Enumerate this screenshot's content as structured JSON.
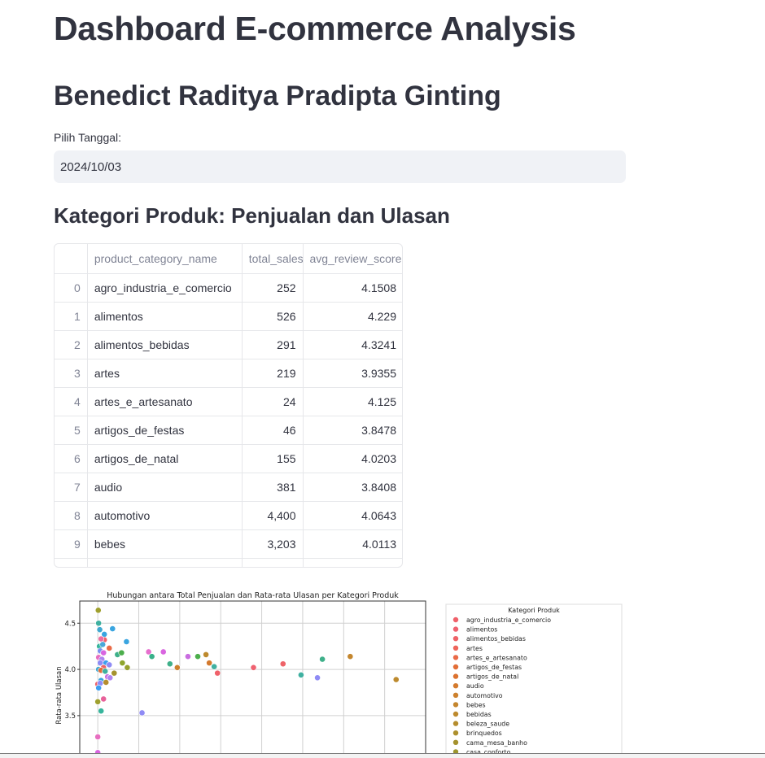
{
  "page": {
    "title": "Dashboard E-commerce Analysis",
    "author": "Benedict Raditya Pradipta Ginting"
  },
  "date_input": {
    "label": "Pilih Tanggal:",
    "value": "2024/10/03"
  },
  "section": {
    "heading": "Kategori Produk: Penjualan dan Ulasan"
  },
  "table": {
    "columns": [
      "",
      "product_category_name",
      "total_sales",
      "avg_review_score"
    ],
    "rows": [
      {
        "index": "0",
        "product_category_name": "agro_industria_e_comercio",
        "total_sales": "252",
        "avg_review_score": "4.1508"
      },
      {
        "index": "1",
        "product_category_name": "alimentos",
        "total_sales": "526",
        "avg_review_score": "4.229"
      },
      {
        "index": "2",
        "product_category_name": "alimentos_bebidas",
        "total_sales": "291",
        "avg_review_score": "4.3241"
      },
      {
        "index": "3",
        "product_category_name": "artes",
        "total_sales": "219",
        "avg_review_score": "3.9355"
      },
      {
        "index": "4",
        "product_category_name": "artes_e_artesanato",
        "total_sales": "24",
        "avg_review_score": "4.125"
      },
      {
        "index": "5",
        "product_category_name": "artigos_de_festas",
        "total_sales": "46",
        "avg_review_score": "3.8478"
      },
      {
        "index": "6",
        "product_category_name": "artigos_de_natal",
        "total_sales": "155",
        "avg_review_score": "4.0203"
      },
      {
        "index": "7",
        "product_category_name": "audio",
        "total_sales": "381",
        "avg_review_score": "3.8408"
      },
      {
        "index": "8",
        "product_category_name": "automotivo",
        "total_sales": "4,400",
        "avg_review_score": "4.0643"
      },
      {
        "index": "9",
        "product_category_name": "bebes",
        "total_sales": "3,203",
        "avg_review_score": "4.0113"
      }
    ]
  },
  "chart_data": {
    "type": "scatter",
    "title": "Hubungan antara Total Penjualan dan Rata-rata Ulasan per Kategori Produk",
    "xlabel": "",
    "ylabel": "Rata-rata Ulasan",
    "y_ticks": [
      "3.5",
      "4.0",
      "4.5"
    ],
    "ylim": [
      3.05,
      4.74
    ],
    "xlim": [
      -1100,
      20000
    ],
    "grid": true,
    "legend": {
      "title": "Kategori Produk",
      "placement": "outside-right",
      "entries": [
        {
          "name": "agro_industria_e_comercio",
          "color": "#f0616a"
        },
        {
          "name": "alimentos",
          "color": "#ef6270"
        },
        {
          "name": "alimentos_bebidas",
          "color": "#ee6368"
        },
        {
          "name": "artes",
          "color": "#ee655b"
        },
        {
          "name": "artes_e_artesanato",
          "color": "#ea6a47"
        },
        {
          "name": "artigos_de_festas",
          "color": "#e36e37"
        },
        {
          "name": "artigos_de_natal",
          "color": "#dc722f"
        },
        {
          "name": "audio",
          "color": "#d47a2e"
        },
        {
          "name": "automotivo",
          "color": "#cd812e"
        },
        {
          "name": "bebes",
          "color": "#c4862e"
        },
        {
          "name": "bebidas",
          "color": "#bd8a2e"
        },
        {
          "name": "beleza_saude",
          "color": "#b58d2e"
        },
        {
          "name": "brinquedos",
          "color": "#ad902e"
        },
        {
          "name": "cama_mesa_banho",
          "color": "#a5922e"
        },
        {
          "name": "casa_conforto",
          "color": "#9d952e"
        }
      ]
    },
    "points": [
      {
        "x": 30,
        "y": 4.64,
        "color": "#9fa02e"
      },
      {
        "x": 50,
        "y": 4.5,
        "color": "#3fb0a0"
      },
      {
        "x": 120,
        "y": 4.43,
        "color": "#41a8d0"
      },
      {
        "x": 400,
        "y": 4.38,
        "color": "#3aa5e0"
      },
      {
        "x": 900,
        "y": 4.44,
        "color": "#3aa5e0"
      },
      {
        "x": 400,
        "y": 4.32,
        "color": "#f0616a"
      },
      {
        "x": 200,
        "y": 4.33,
        "color": "#ee6ea0"
      },
      {
        "x": 100,
        "y": 4.25,
        "color": "#37b59c"
      },
      {
        "x": 300,
        "y": 4.27,
        "color": "#4aa8d8"
      },
      {
        "x": 700,
        "y": 4.23,
        "color": "#ea6a47"
      },
      {
        "x": 150,
        "y": 4.2,
        "color": "#7b91f0"
      },
      {
        "x": 350,
        "y": 4.18,
        "color": "#d965e0"
      },
      {
        "x": 1200,
        "y": 4.16,
        "color": "#3fb08a"
      },
      {
        "x": 1450,
        "y": 4.18,
        "color": "#4cae4c"
      },
      {
        "x": 1750,
        "y": 4.3,
        "color": "#3aa5e0"
      },
      {
        "x": 50,
        "y": 4.13,
        "color": "#e76ec0"
      },
      {
        "x": 250,
        "y": 4.11,
        "color": "#ae84f0"
      },
      {
        "x": 500,
        "y": 4.07,
        "color": "#3c9ef0"
      },
      {
        "x": 150,
        "y": 4.07,
        "color": "#8f8bf5"
      },
      {
        "x": 700,
        "y": 4.05,
        "color": "#8f8bf5"
      },
      {
        "x": 1500,
        "y": 4.07,
        "color": "#8fa62e"
      },
      {
        "x": 1800,
        "y": 4.02,
        "color": "#97a12e"
      },
      {
        "x": 350,
        "y": 4.02,
        "color": "#ee6368"
      },
      {
        "x": 50,
        "y": 4.0,
        "color": "#41a8d0"
      },
      {
        "x": 200,
        "y": 3.99,
        "color": "#e36e37"
      },
      {
        "x": 450,
        "y": 3.98,
        "color": "#3fb0a0"
      },
      {
        "x": 1000,
        "y": 3.96,
        "color": "#a5922e"
      },
      {
        "x": 600,
        "y": 3.92,
        "color": "#c96de0"
      },
      {
        "x": 750,
        "y": 3.91,
        "color": "#b084f0"
      },
      {
        "x": 200,
        "y": 3.88,
        "color": "#3aa5e0"
      },
      {
        "x": 500,
        "y": 3.86,
        "color": "#b58d2e"
      },
      {
        "x": 0,
        "y": 3.84,
        "color": "#ee6368"
      },
      {
        "x": 150,
        "y": 3.85,
        "color": "#8f8bf5"
      },
      {
        "x": 50,
        "y": 3.8,
        "color": "#3c9ef0"
      },
      {
        "x": 350,
        "y": 3.68,
        "color": "#e8619a"
      },
      {
        "x": 0,
        "y": 3.65,
        "color": "#9fa02e"
      },
      {
        "x": 200,
        "y": 3.55,
        "color": "#37b59c"
      },
      {
        "x": 2700,
        "y": 3.53,
        "color": "#8f8bf5"
      },
      {
        "x": 3100,
        "y": 4.19,
        "color": "#e66fce"
      },
      {
        "x": 3300,
        "y": 4.14,
        "color": "#39b08a"
      },
      {
        "x": 4000,
        "y": 4.19,
        "color": "#d965e0"
      },
      {
        "x": 4400,
        "y": 4.06,
        "color": "#3fb08a"
      },
      {
        "x": 4850,
        "y": 4.02,
        "color": "#cd812e"
      },
      {
        "x": 5500,
        "y": 4.14,
        "color": "#c96de0"
      },
      {
        "x": 6100,
        "y": 4.14,
        "color": "#4cae4c"
      },
      {
        "x": 6600,
        "y": 4.16,
        "color": "#bd8a2e"
      },
      {
        "x": 6800,
        "y": 4.07,
        "color": "#d47a2e"
      },
      {
        "x": 7100,
        "y": 4.03,
        "color": "#3fb0a0"
      },
      {
        "x": 7300,
        "y": 3.96,
        "color": "#f0616a"
      },
      {
        "x": 9500,
        "y": 4.02,
        "color": "#ef6270"
      },
      {
        "x": 11300,
        "y": 4.06,
        "color": "#ee6368"
      },
      {
        "x": 12400,
        "y": 3.94,
        "color": "#3fb0a0"
      },
      {
        "x": 13400,
        "y": 3.91,
        "color": "#8f8bf5"
      },
      {
        "x": 13700,
        "y": 4.11,
        "color": "#3fb08a"
      },
      {
        "x": 15400,
        "y": 4.14,
        "color": "#c4862e"
      },
      {
        "x": 18200,
        "y": 3.89,
        "color": "#bd8a2e"
      },
      {
        "x": 0,
        "y": 3.27,
        "color": "#e76ec0"
      },
      {
        "x": 0,
        "y": 3.1,
        "color": "#d965e0"
      }
    ]
  }
}
